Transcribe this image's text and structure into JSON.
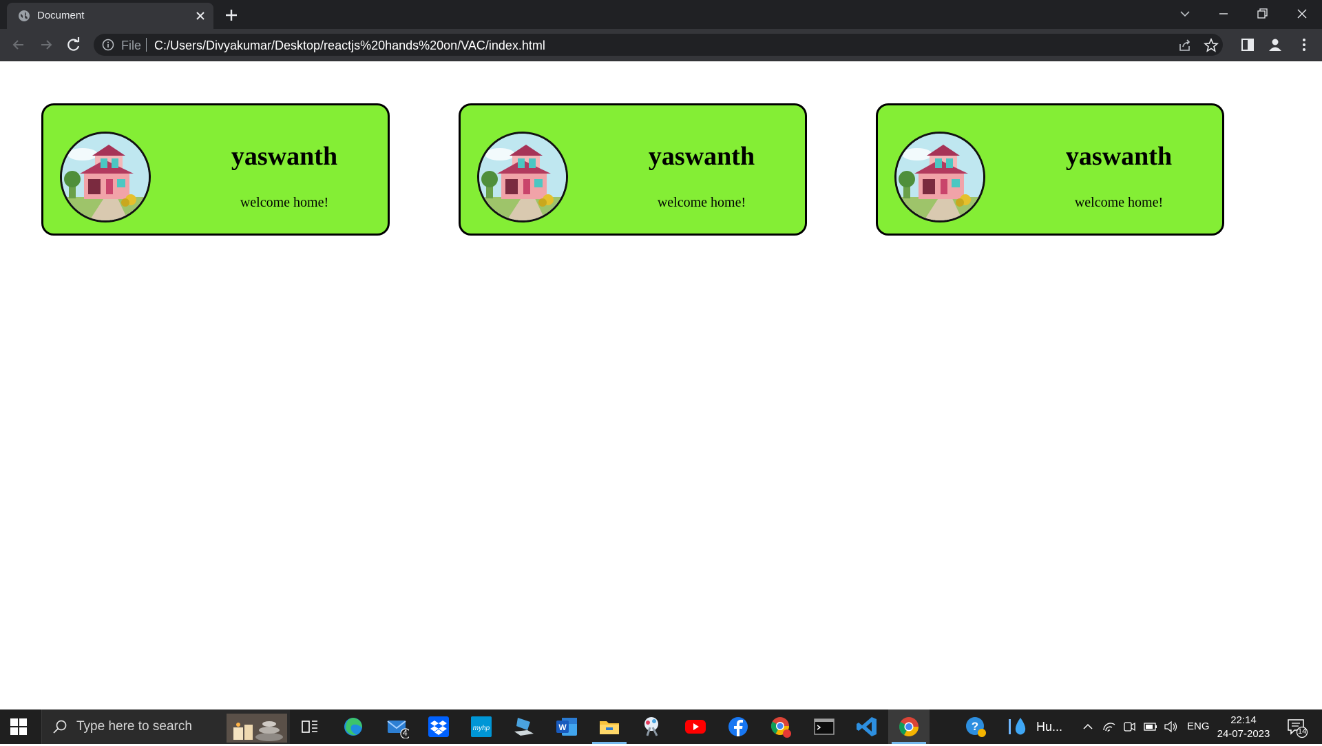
{
  "browser": {
    "tab_title": "Document",
    "address": {
      "security_label": "File",
      "url": "C:/Users/Divyakumar/Desktop/reactjs%20hands%20on/VAC/index.html"
    }
  },
  "page": {
    "cards": [
      {
        "name": "yaswanth",
        "message": "welcome home!"
      },
      {
        "name": "yaswanth",
        "message": "welcome home!"
      },
      {
        "name": "yaswanth",
        "message": "welcome home!"
      }
    ],
    "colors": {
      "card_background": "#84ee35",
      "card_border": "#000000"
    }
  },
  "taskbar": {
    "search_placeholder": "Type here to search",
    "mail_badge": "4",
    "weather_label": "Hu...",
    "language": "ENG",
    "time": "22:14",
    "date": "24-07-2023",
    "notification_count": "14",
    "apps": [
      "task-view",
      "edge",
      "mail",
      "dropbox",
      "myhp",
      "laptop-app",
      "word",
      "file-explorer",
      "snip-tool",
      "youtube",
      "facebook",
      "chrome-profile",
      "terminal",
      "vscode",
      "chrome"
    ]
  }
}
